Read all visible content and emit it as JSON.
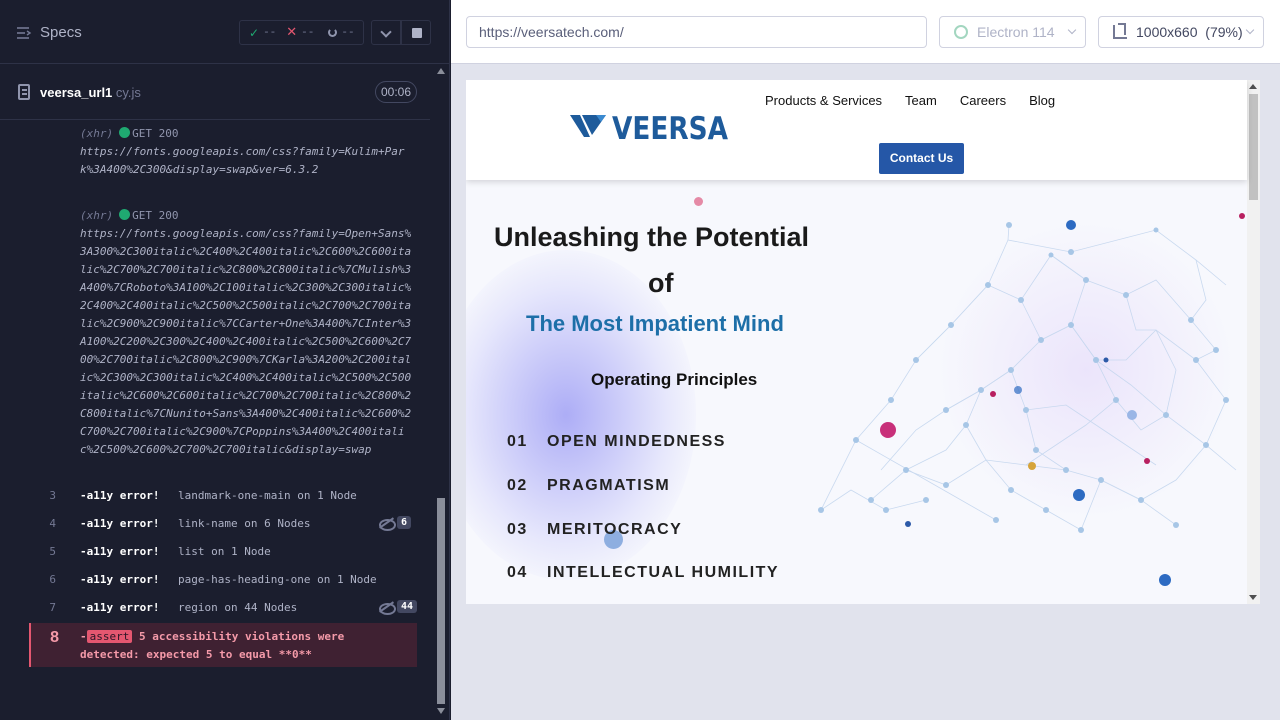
{
  "runner": {
    "specs_title": "Specs",
    "stats": {
      "passed": "--",
      "failed": "--",
      "pending": "--"
    },
    "spec_file": {
      "name": "veersa_url1",
      "ext": " cy.js",
      "duration": "00:06"
    },
    "xhr1": {
      "label": "(xhr)",
      "method": "GET 200",
      "url": "https://fonts.googleapis.com/css?family=Kulim+Park%3A400%2C300&display=swap&ver=6.3.2"
    },
    "xhr2": {
      "label": "(xhr)",
      "method": "GET 200",
      "url": "https://fonts.googleapis.com/css?family=Open+Sans%3A300%2C300italic%2C400%2C400italic%2C600%2C600italic%2C700%2C700italic%2C800%2C800italic%7CMulish%3A400%7CRoboto%3A100%2C100italic%2C300%2C300italic%2C400%2C400italic%2C500%2C500italic%2C700%2C700italic%2C900%2C900italic%7CCarter+One%3A400%7CInter%3A100%2C200%2C300%2C400%2C400italic%2C500%2C600%2C700%2C700italic%2C800%2C900%7CKarla%3A200%2C200italic%2C300%2C300italic%2C400%2C400italic%2C500%2C500italic%2C600%2C600italic%2C700%2C700italic%2C800%2C800italic%7CNunito+Sans%3A400%2C400italic%2C600%2C700%2C700italic%2C900%7CPoppins%3A400%2C400italic%2C500%2C600%2C700%2C700italic&display=swap"
    },
    "commands": [
      {
        "num": "3",
        "cmd": "-a11y error!",
        "msg": "landmark-one-main on 1 Node",
        "count": ""
      },
      {
        "num": "4",
        "cmd": "-a11y error!",
        "msg": "link-name on 6 Nodes",
        "count": "6"
      },
      {
        "num": "5",
        "cmd": "-a11y error!",
        "msg": "list on 1 Node",
        "count": ""
      },
      {
        "num": "6",
        "cmd": "-a11y error!",
        "msg": "page-has-heading-one on 1 Node",
        "count": ""
      },
      {
        "num": "7",
        "cmd": "-a11y error!",
        "msg": "region on 44 Nodes",
        "count": "44"
      }
    ],
    "assert": {
      "num": "8",
      "prefix": "-",
      "tag": "assert",
      "text1": " 5 accessibility violations were detected: expected ",
      "expected": "5",
      "text2": " to equal ",
      "actual": "**0**"
    }
  },
  "aut": {
    "url": "https://veersatech.com/",
    "browser": "Electron 114",
    "viewport": "1000x660",
    "zoom": "(79%)",
    "site": {
      "logo": "VEERSA",
      "nav": [
        "Products & Services",
        "Team",
        "Careers",
        "Blog"
      ],
      "contact": "Contact Us",
      "hero_line1": "Unleashing the Potential",
      "hero_line2": "of",
      "hero_line3": "The Most Impatient Mind",
      "subheading": "Operating Principles",
      "principles": [
        {
          "num": "01",
          "text": "OPEN MINDEDNESS"
        },
        {
          "num": "02",
          "text": "PRAGMATISM"
        },
        {
          "num": "03",
          "text": "MERITOCRACY"
        },
        {
          "num": "04",
          "text": "INTELLECTUAL HUMILITY"
        }
      ]
    }
  },
  "colors": {
    "pass": "#1fa971",
    "fail": "#e45770",
    "brand": "#1e5b9b",
    "accent": "#2557a7"
  }
}
